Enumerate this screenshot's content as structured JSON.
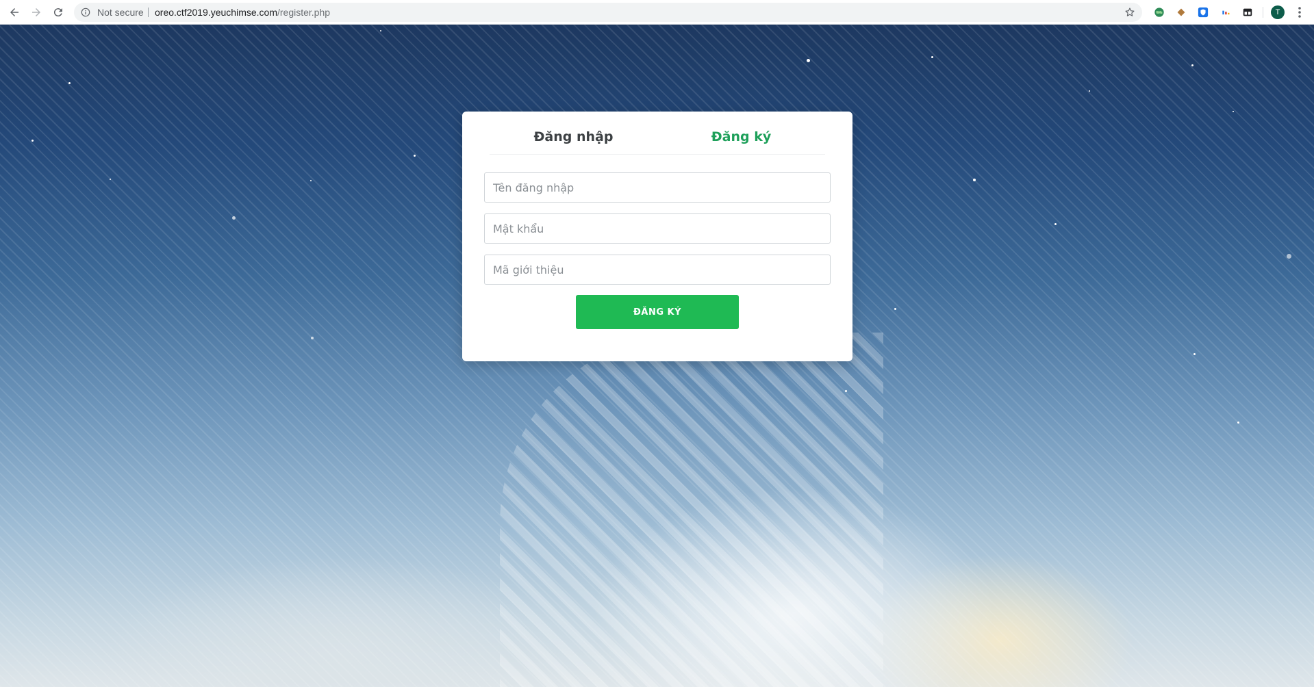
{
  "browser": {
    "security_label": "Not secure",
    "url_host": "oreo.ctf2019.yeuchimse.com",
    "url_path": "/register.php",
    "profile_initial": "T",
    "icons": [
      "back-arrow-icon",
      "forward-arrow-icon",
      "reload-icon",
      "info-icon",
      "bookmark-star-icon",
      "extension-globe-icon",
      "extension-cookie-icon",
      "extension-shield-icon",
      "extension-dots-icon",
      "extension-tab-icon",
      "menu-dots-icon"
    ]
  },
  "form": {
    "tabs": [
      {
        "label": "Đăng nhập",
        "active": false
      },
      {
        "label": "Đăng ký",
        "active": true
      }
    ],
    "username_placeholder": "Tên đăng nhập",
    "password_placeholder": "Mật khẩu",
    "referral_placeholder": "Mã giới thiệu",
    "submit_label": "ĐĂNG KÝ"
  },
  "colors": {
    "accent": "#1ea05a",
    "button": "#1fba54"
  }
}
